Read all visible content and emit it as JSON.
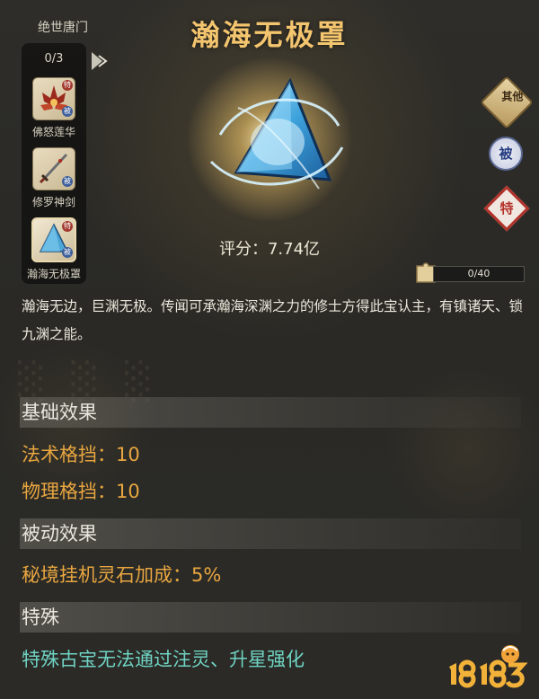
{
  "set": {
    "title": "绝世唐门",
    "count": "0/3",
    "items": [
      {
        "name": "佛怒莲华",
        "tag_top": "特",
        "tag_bottom": "被"
      },
      {
        "name": "修罗神剑",
        "tag_top": "",
        "tag_bottom": "被"
      },
      {
        "name": "瀚海无极罩",
        "tag_top": "特",
        "tag_bottom": "被"
      }
    ]
  },
  "item": {
    "title": "瀚海无极罩",
    "score": "评分：7.74亿",
    "description": "瀚海无边，巨渊无极。传闻可承瀚海深渊之力的修士方得此宝认主，有镇诸天、锁九渊之能。"
  },
  "badges": {
    "other": "其他",
    "passive": "被",
    "special": "特"
  },
  "fragments": {
    "text": "0/40",
    "progress": 0
  },
  "sections": {
    "basic": {
      "header": "基础效果",
      "lines": [
        "法术格挡：10",
        "物理格挡：10"
      ]
    },
    "passive": {
      "header": "被动效果",
      "lines": [
        "秘境挂机灵石加成：5%"
      ]
    },
    "special": {
      "header": "特殊",
      "lines": [
        "特殊古宝无法通过注灵、升星强化"
      ]
    }
  },
  "watermark": {
    "site": "18183"
  },
  "colors": {
    "title_gold": "#f3c56e",
    "effect_orange": "#e8a640",
    "special_teal": "#6fd3c2"
  }
}
